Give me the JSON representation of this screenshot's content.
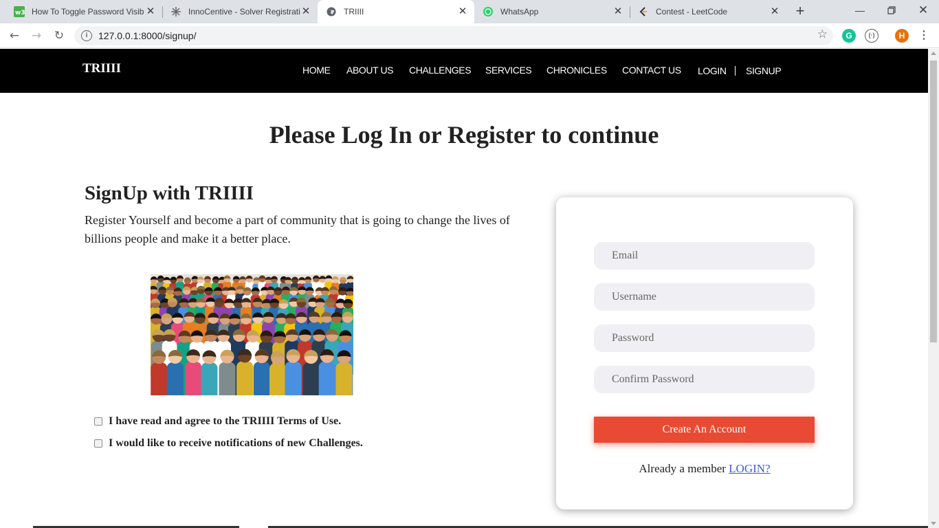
{
  "browser": {
    "tabs": [
      {
        "title": "How To Toggle Password Visibi",
        "icon": "w3schools-icon"
      },
      {
        "title": "InnoCentive - Solver Registrati",
        "icon": "innocentive-icon"
      },
      {
        "title": "TRIIII",
        "icon": "globe-icon"
      },
      {
        "title": "WhatsApp",
        "icon": "whatsapp-icon"
      },
      {
        "title": "Contest - LeetCode",
        "icon": "leetcode-icon"
      }
    ],
    "active_tab": 2,
    "url": "127.0.0.1:8000/signup/",
    "profile_initial": "H",
    "colors": {
      "tabstrip": "#dee1e6",
      "omnibox": "#f1f3f4",
      "profile": "#e8710a",
      "grammarly": "#15c39a"
    }
  },
  "site": {
    "brand": "TRIIII",
    "nav": [
      "HOME",
      "ABOUT US",
      "CHALLENGES",
      "SERVICES",
      "CHRONICLES",
      "CONTACT US",
      "LOGIN",
      "SIGNUP"
    ]
  },
  "main": {
    "title": "Please Log In or Register to continue",
    "signup_heading": "SignUp with TRIIII",
    "signup_description": "Register Yourself and become a part of community that is going to change the lives of billions people and make it a better place.",
    "checkboxes": [
      {
        "label": "I have read and agree to the TRIIII Terms of Use.",
        "checked": false
      },
      {
        "label": "I would like to receive notifications of new Challenges.",
        "checked": false
      }
    ]
  },
  "form": {
    "email_placeholder": "Email",
    "username_placeholder": "Username",
    "password_placeholder": "Password",
    "confirm_placeholder": "Confirm Password",
    "submit_label": "Create An Account",
    "member_text": "Already a member",
    "login_link": "LOGIN?",
    "button_color": "#e84a33"
  }
}
